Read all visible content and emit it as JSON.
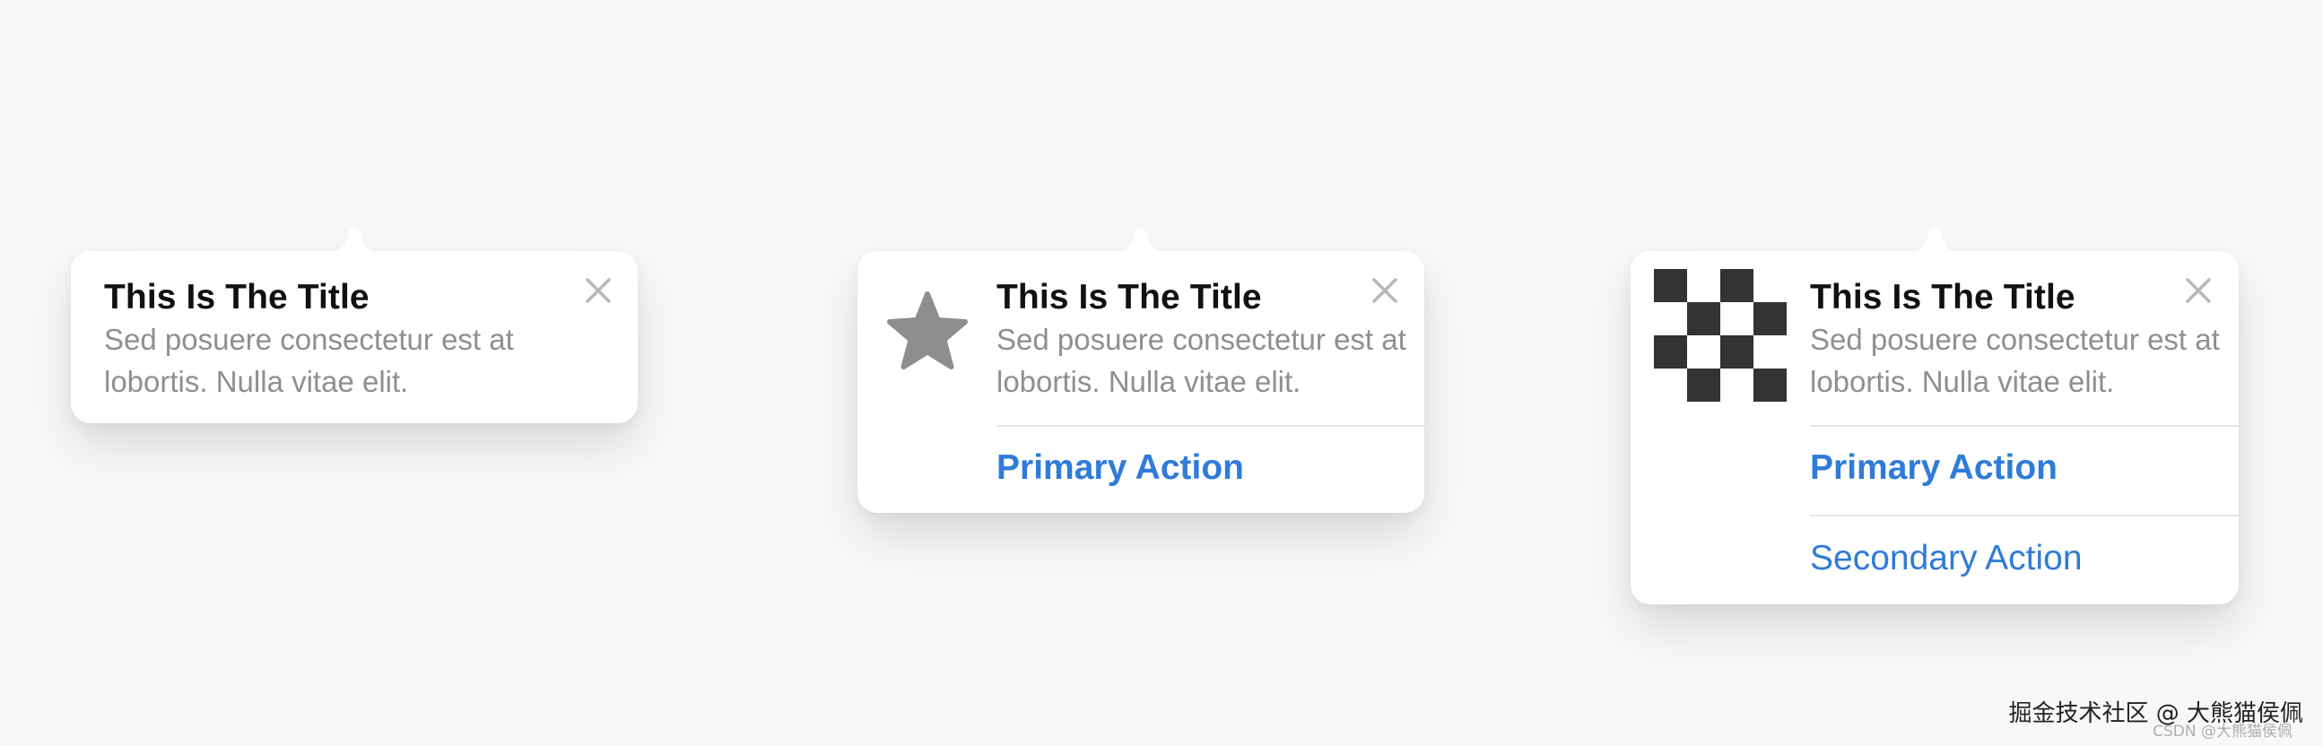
{
  "tips": [
    {
      "title": "This Is The Title",
      "body": "Sed posuere consectetur est at lobortis. Nulla vitae elit."
    },
    {
      "icon": "star-icon",
      "title": "This Is The Title",
      "body": "Sed posuere consectetur est at lobortis. Nulla vitae elit.",
      "primary_action": "Primary Action"
    },
    {
      "icon": "checkerboard-icon",
      "title": "This Is The Title",
      "body": "Sed posuere consectetur est at lobortis. Nulla vitae elit.",
      "primary_action": "Primary Action",
      "secondary_action": "Secondary Action"
    }
  ],
  "close_icon": "close-icon",
  "colors": {
    "background": "#f8f8f8",
    "card": "#ffffff",
    "title": "#111111",
    "body": "#8e8e93",
    "action": "#2f7bd9",
    "close": "#b8b8bc",
    "star": "#8e8e8e",
    "checker": "#333333"
  },
  "watermark": {
    "main": "掘金技术社区 @ 大熊猫侯佩",
    "sub": "CSDN @大熊猫侯佩"
  }
}
